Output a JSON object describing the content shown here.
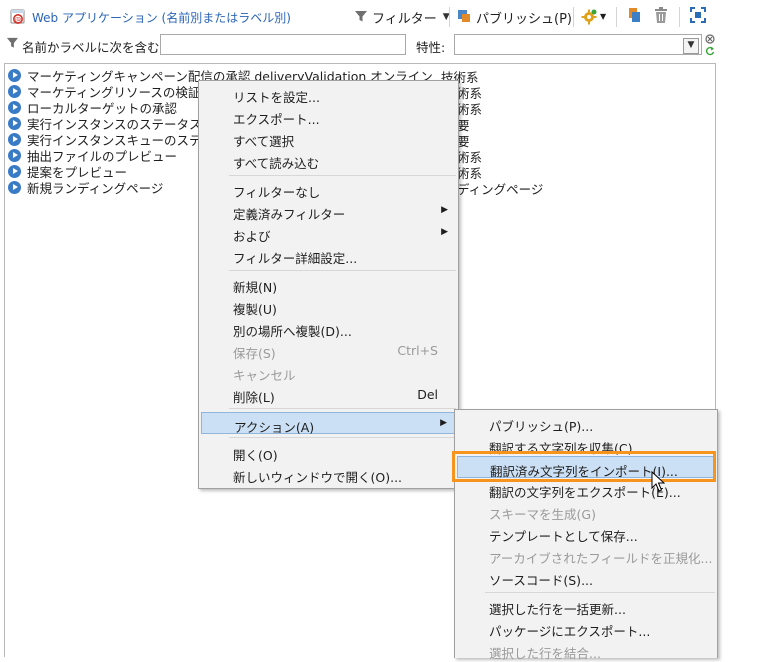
{
  "header": {
    "title": "Web アプリケーション (名前別またはラベル別)",
    "filter_label": "フィルター",
    "publish_label": "パブリッシュ(P)",
    "icons": [
      "app-icon",
      "funnel-icon",
      "publish-icon",
      "gear-icon",
      "send-icon",
      "trash-icon",
      "fullscreen-icon"
    ]
  },
  "filter_bar": {
    "name_label": "名前かラベルに次を含む:",
    "name_value": "",
    "attribute_label": "特性:",
    "attribute_value": ""
  },
  "list": {
    "rows": [
      {
        "name": "マーケティングキャンペーン配信の承認 deliveryValidation オンライン",
        "category": "技術系"
      },
      {
        "name": "マーケティングリソースの検証",
        "category": "術系"
      },
      {
        "name": "ローカルターゲットの承認",
        "category": "術系"
      },
      {
        "name": "実行インスタンスのステータス",
        "category": "要"
      },
      {
        "name": "実行インスタンスキューのステータス",
        "category": "要"
      },
      {
        "name": "抽出ファイルのプレビュー",
        "category": "術系"
      },
      {
        "name": "提案をプレビュー",
        "category": "術系"
      },
      {
        "name": "新規ランディングページ",
        "category": "ディングページ"
      }
    ]
  },
  "context_menu": {
    "items": [
      {
        "label": "リストを設定...",
        "shortcut": "",
        "disabled": false,
        "submenu": false
      },
      {
        "label": "エクスポート...",
        "shortcut": "",
        "disabled": false,
        "submenu": false
      },
      {
        "label": "すべて選択",
        "shortcut": "",
        "disabled": false,
        "submenu": false
      },
      {
        "label": "すべて読み込む",
        "shortcut": "",
        "disabled": false,
        "submenu": false
      },
      {
        "label": "フィルターなし",
        "shortcut": "",
        "disabled": false,
        "submenu": false
      },
      {
        "label": "定義済みフィルター",
        "shortcut": "",
        "disabled": false,
        "submenu": true
      },
      {
        "label": "および",
        "shortcut": "",
        "disabled": false,
        "submenu": true
      },
      {
        "label": "フィルター詳細設定...",
        "shortcut": "",
        "disabled": false,
        "submenu": false
      },
      {
        "label": "新規(N)",
        "shortcut": "",
        "disabled": false,
        "submenu": false
      },
      {
        "label": "複製(U)",
        "shortcut": "",
        "disabled": false,
        "submenu": false
      },
      {
        "label": "別の場所へ複製(D)...",
        "shortcut": "",
        "disabled": false,
        "submenu": false
      },
      {
        "label": "保存(S)",
        "shortcut": "Ctrl+S",
        "disabled": true,
        "submenu": false
      },
      {
        "label": "キャンセル",
        "shortcut": "",
        "disabled": true,
        "submenu": false
      },
      {
        "label": "削除(L)",
        "shortcut": "Del",
        "disabled": false,
        "submenu": false
      },
      {
        "label": "アクション(A)",
        "shortcut": "",
        "disabled": false,
        "submenu": true,
        "selected": true
      },
      {
        "label": "開く(O)",
        "shortcut": "",
        "disabled": false,
        "submenu": false
      },
      {
        "label": "新しいウィンドウで開く(O)...",
        "shortcut": "",
        "disabled": false,
        "submenu": false
      }
    ]
  },
  "action_submenu": {
    "items": [
      {
        "label": "パブリッシュ(P)...",
        "disabled": false
      },
      {
        "label": "翻訳する文字列を収集(C)...",
        "disabled": false
      },
      {
        "label": "翻訳済み文字列をインポート(I)...",
        "disabled": false,
        "highlighted": true
      },
      {
        "label": "翻訳の文字列をエクスポート(E)...",
        "disabled": false
      },
      {
        "label": "スキーマを生成(G)",
        "disabled": true
      },
      {
        "label": "テンプレートとして保存...",
        "disabled": false
      },
      {
        "label": "アーカイブされたフィールドを正規化...",
        "disabled": true
      },
      {
        "label": "ソースコード(S)...",
        "disabled": false
      },
      {
        "label": "選択した行を一括更新...",
        "disabled": false
      },
      {
        "label": "パッケージにエクスポート...",
        "disabled": false
      },
      {
        "label": "選択した行を結合...",
        "disabled": true
      }
    ]
  },
  "colors": {
    "accent": "#2a65b8",
    "highlight": "#f7941d",
    "menu_bg": "#f2f2f2",
    "selected_bg": "#cce0f5"
  }
}
